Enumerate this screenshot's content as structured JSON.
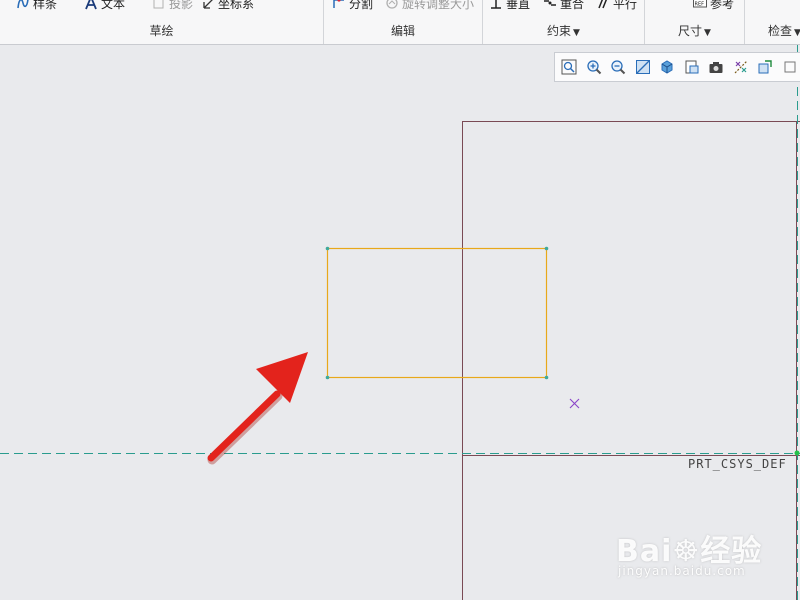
{
  "ribbon": {
    "tools": {
      "spline": "样条",
      "text": "文本",
      "project": "投影",
      "coordinate_system": "坐标系",
      "divide": "分割",
      "rotate_resize": "旋转调整大小",
      "vertical": "垂直",
      "coincident": "重合",
      "parallel": "平行",
      "reference": "参考"
    },
    "groups": {
      "sketch": "草绘",
      "edit": "编辑",
      "constrain": "约束",
      "dimension": "尺寸",
      "inspect": "检查"
    }
  },
  "canvas": {
    "csys_label": "PRT_CSYS_DEF",
    "colors": {
      "background": "#e9eaed",
      "sketch_rectangle": "#e8a81a",
      "sketch_vertex": "#3fa99b",
      "reference_line": "#2a9c8e",
      "frame_line": "#7a4a55",
      "marker": "#8a44c8",
      "arrow": "#e3231c"
    }
  },
  "watermark": {
    "logo": "Bai",
    "logo_cn": "经验",
    "url": "jingyan.baidu.com"
  }
}
